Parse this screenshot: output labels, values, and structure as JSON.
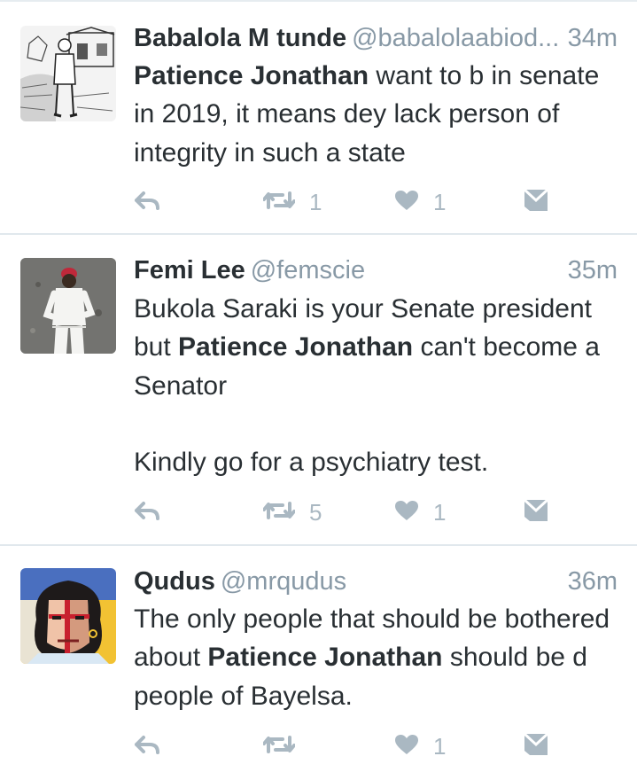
{
  "tweets": [
    {
      "name": "Babalola M tunde",
      "handle": "@babalolaabiod...",
      "time": "34m",
      "body_pre": "",
      "body_bold": "Patience Jonathan",
      "body_post": " want to b in senate in 2019, it means dey lack person of integrity in such a state",
      "retweets": "1",
      "likes": "1",
      "avatar_icon": "sketch-man-avatar"
    },
    {
      "name": "Femi Lee",
      "handle": "@femscie",
      "time": "35m",
      "body_pre": "Bukola Saraki is your Senate president but ",
      "body_bold": "Patience Jonathan",
      "body_post": " can't become a Senator\n\nKindly go for a psychiatry test.",
      "retweets": "5",
      "likes": "1",
      "avatar_icon": "photo-man-white-outfit-avatar"
    },
    {
      "name": "Qudus",
      "handle": "@mrqudus",
      "time": "36m",
      "body_pre": "The only people that should be bothered about ",
      "body_bold": "Patience Jonathan",
      "body_post": " should be d people of Bayelsa.",
      "retweets": "",
      "likes": "1",
      "avatar_icon": "illustrated-face-avatar"
    }
  ],
  "icons": {
    "reply": "reply-icon",
    "retweet": "retweet-icon",
    "like": "heart-icon",
    "dm": "direct-message-icon"
  },
  "colors": {
    "icon_gray": "#aab8c2",
    "meta_gray": "#8899a6",
    "text": "#292f33",
    "divider": "#e1e8ed"
  }
}
